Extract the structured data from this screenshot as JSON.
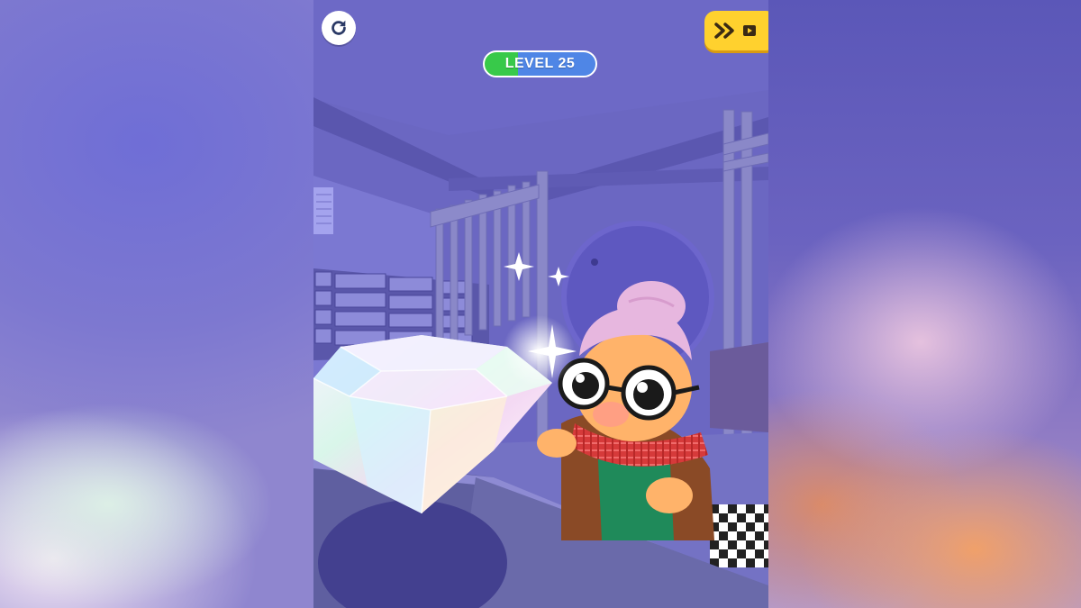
{
  "hud": {
    "level_label": "LEVEL 25",
    "level_progress": 0.3,
    "restart_icon": "restart-icon",
    "skip_icons": [
      "fast-forward-icon",
      "video-ad-icon"
    ]
  },
  "colors": {
    "progress_fill": "#38c94a",
    "progress_track": "#4f86e6",
    "skip_button": "#ffd12e",
    "wall": "#6a66c0"
  }
}
